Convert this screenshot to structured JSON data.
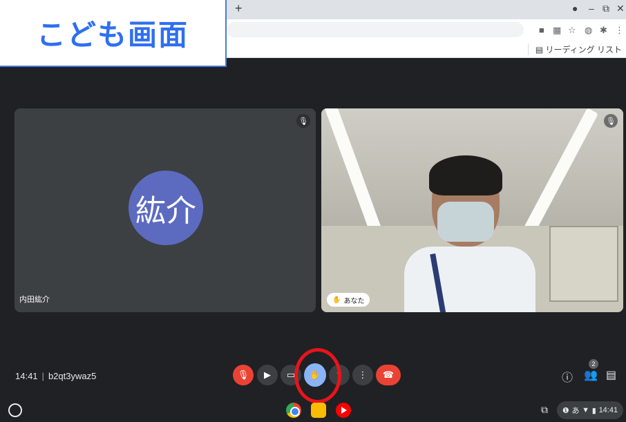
{
  "overlay": {
    "label": "こども画面"
  },
  "browser": {
    "new_tab": "+",
    "reading_list": "リーディング リスト"
  },
  "tiles": {
    "left": {
      "avatar_text": "紘介",
      "name": "内田紘介"
    },
    "right": {
      "you_label": "あなた"
    }
  },
  "meeting": {
    "time": "14:41",
    "code": "b2qt3ywaz5",
    "participant_count": "2"
  },
  "tray": {
    "time": "14:41",
    "ime": "あ"
  },
  "colors": {
    "end_call": "#ea4335",
    "hand_raise": "#8ab4f8",
    "highlight": "#e8141b",
    "label_text": "#2f6ff0"
  }
}
